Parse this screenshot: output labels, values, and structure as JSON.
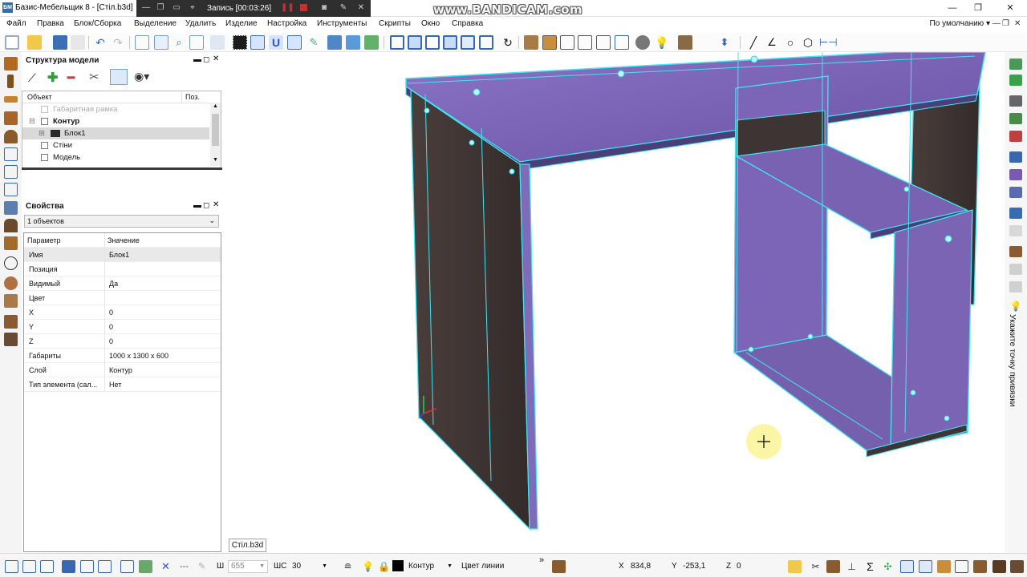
{
  "window": {
    "title": "Базис-Мебельщик 8 - [Стіл.b3d]",
    "icon_text": "БМ",
    "watermark": "www.BANDICAM.com",
    "recording": {
      "label": "Запись [00:03:26]"
    }
  },
  "menu": {
    "items": [
      "Файл",
      "Правка",
      "Блок/Сборка",
      "Выделение",
      "Удалить",
      "Изделие",
      "Настройка",
      "Инструменты",
      "Скрипты",
      "Окно",
      "Справка"
    ],
    "preset": "По умолчанию",
    "preset_arrow": "▾"
  },
  "colors": {
    "accent": "#2d6fb0",
    "panel_cyan": "#3fe6f4",
    "wood_purple": "#7a62b2",
    "wood_dark": "#3e3433",
    "record_red": "#d22b2b",
    "cursor_highlight": "#fbf6a5"
  },
  "tree": {
    "title": "Структура модели",
    "columns": {
      "object": "Объект",
      "pos": "Поз."
    },
    "rows": [
      {
        "label": "Габаритная рамка",
        "muted": true
      },
      {
        "label": "Контур",
        "bold": true
      },
      {
        "label": "Блок1",
        "selected": true
      },
      {
        "label": "Стіни"
      },
      {
        "label": "Модель"
      }
    ]
  },
  "properties": {
    "title": "Свойства",
    "selection": "1 объектов",
    "header": {
      "param": "Параметр",
      "value": "Значение"
    },
    "rows": [
      {
        "name": "Имя",
        "value": "Блок1"
      },
      {
        "name": "Позиция",
        "value": ""
      },
      {
        "name": "Видимый",
        "value": "Да"
      },
      {
        "name": "Цвет",
        "value": ""
      },
      {
        "name": "X",
        "value": "0"
      },
      {
        "name": "Y",
        "value": "0"
      },
      {
        "name": "Z",
        "value": "0"
      },
      {
        "name": "Габариты",
        "value": "1000 x 1300 x 600"
      },
      {
        "name": "Слой",
        "value": "Контур"
      },
      {
        "name": "Тип элемента (сал...",
        "value": "Нет"
      }
    ]
  },
  "document_tab": "Стіл.b3d",
  "hint": "Укажите точку привязки",
  "status": {
    "step_label": "Ш",
    "step_value": "655",
    "grid_label": "ШС",
    "grid_value": "30",
    "layer": "Контур",
    "line_color": "Цвет линии",
    "x_label": "X",
    "x_value": "834,8",
    "y_label": "Y",
    "y_value": "-253,1",
    "z_label": "Z",
    "z_value": "0"
  }
}
